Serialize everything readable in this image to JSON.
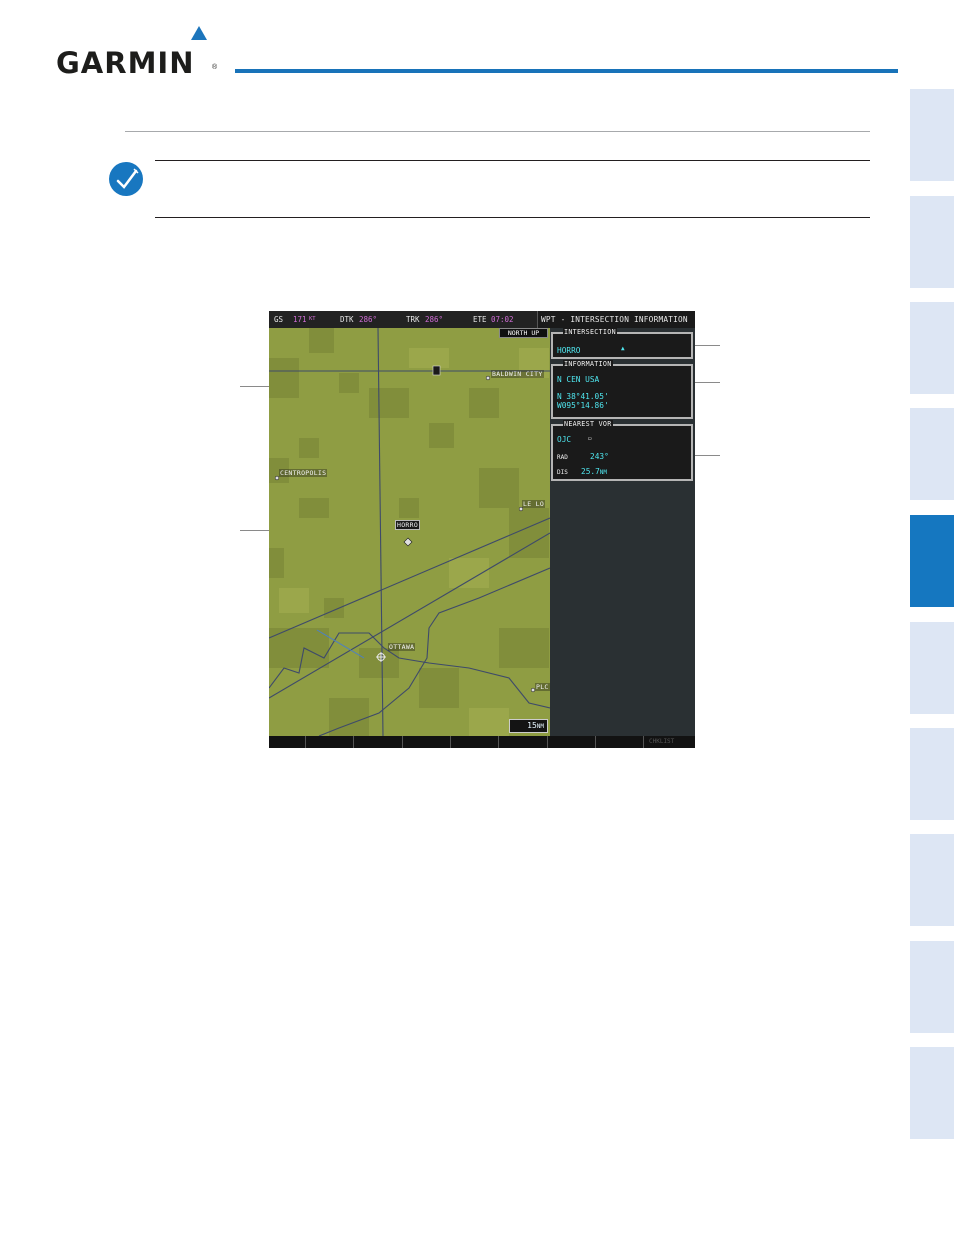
{
  "header": {
    "brand": "GARMIN",
    "registered": "®"
  },
  "display": {
    "databar": {
      "gs_label": "GS",
      "gs_value": "171",
      "gs_unit": "KT",
      "dtk_label": "DTK",
      "dtk_value": "286°",
      "trk_label": "TRK",
      "trk_value": "286°",
      "ete_label": "ETE",
      "ete_value": "07:02"
    },
    "page_title": "WPT - INTERSECTION INFORMATION",
    "map": {
      "orientation": "NORTH UP",
      "range_value": "15",
      "range_unit": "NM",
      "labels": {
        "baldwin_city": "BALDWIN CITY",
        "centropolis": "CENTROPOLIS",
        "le_loup": "LE LO",
        "horro": "HORRO",
        "ottawa": "OTTAWA",
        "pl": "PLC"
      },
      "colors": {
        "land_light": "#8f9d43",
        "land_dark": "#7d8a39",
        "route": "#3e4a6a"
      }
    },
    "intersection_box": {
      "title": "INTERSECTION",
      "identifier": "HORRO"
    },
    "information_box": {
      "title": "INFORMATION",
      "region": "N CEN USA",
      "latitude": "N 38°41.05'",
      "longitude": "W095°14.86'"
    },
    "nearest_vor_box": {
      "title": "NEAREST VOR",
      "identifier": "OJC",
      "rad_label": "RAD",
      "rad_value": "243°",
      "dis_label": "DIS",
      "dis_value": "25.7",
      "dis_unit": "NM"
    },
    "softkeys": {
      "last_label": "CHKLIST"
    }
  },
  "side_tabs": {
    "count": 10,
    "active_index": 4,
    "active_color": "#1577c0",
    "inactive_color": "#dde6f4"
  }
}
